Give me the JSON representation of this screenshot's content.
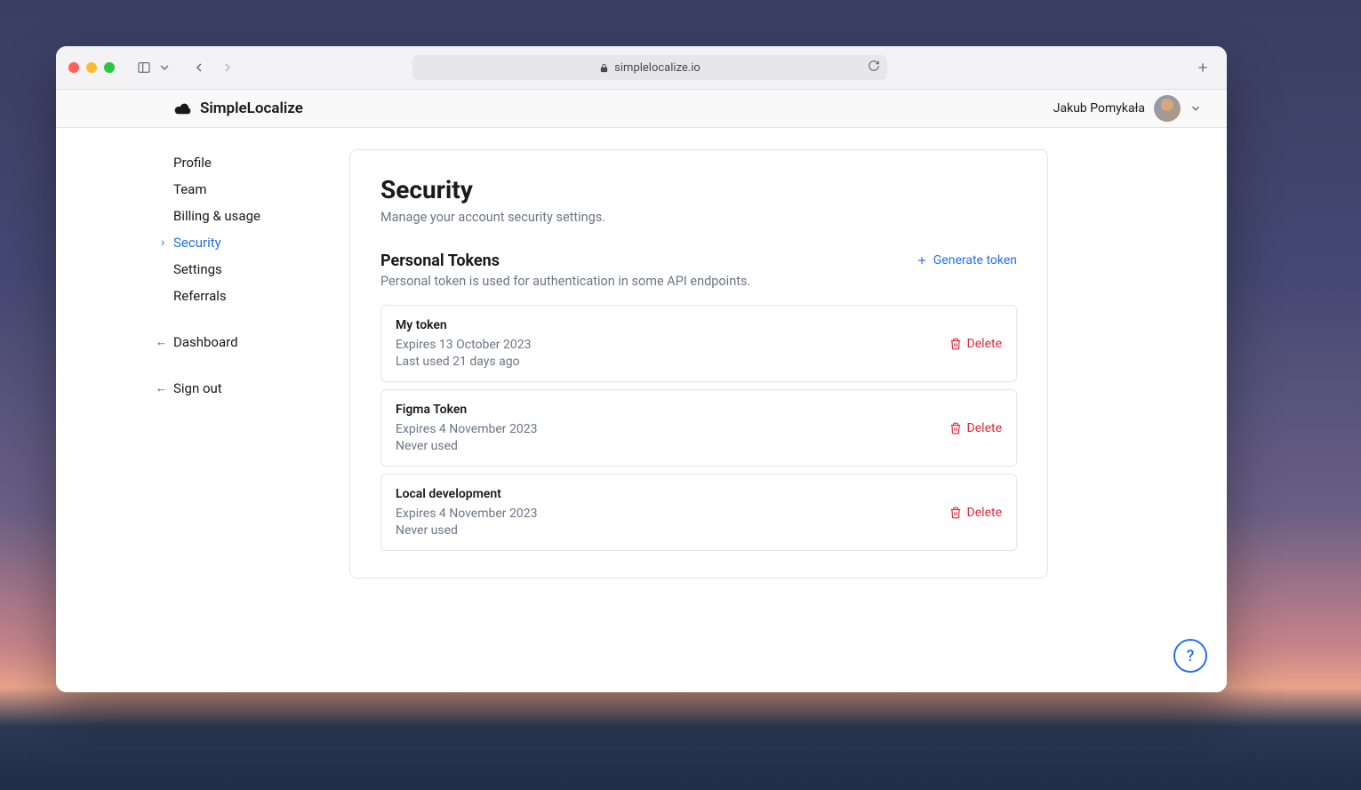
{
  "browser": {
    "url": "simplelocalize.io"
  },
  "brand": {
    "name": "SimpleLocalize"
  },
  "user": {
    "name": "Jakub Pomykała"
  },
  "sidebar": {
    "items": [
      {
        "label": "Profile"
      },
      {
        "label": "Team"
      },
      {
        "label": "Billing & usage"
      },
      {
        "label": "Security"
      },
      {
        "label": "Settings"
      },
      {
        "label": "Referrals"
      }
    ],
    "dashboard_label": "Dashboard",
    "signout_label": "Sign out"
  },
  "page": {
    "title": "Security",
    "subtitle": "Manage your account security settings."
  },
  "tokens_section": {
    "title": "Personal Tokens",
    "subtitle": "Personal token is used for authentication in some API endpoints.",
    "generate_label": "Generate token",
    "delete_label": "Delete"
  },
  "tokens": [
    {
      "name": "My token",
      "expires": "Expires 13 October 2023",
      "last_used": "Last used 21 days ago"
    },
    {
      "name": "Figma Token",
      "expires": "Expires 4 November 2023",
      "last_used": "Never used"
    },
    {
      "name": "Local development",
      "expires": "Expires 4 November 2023",
      "last_used": "Never used"
    }
  ],
  "help_label": "?"
}
